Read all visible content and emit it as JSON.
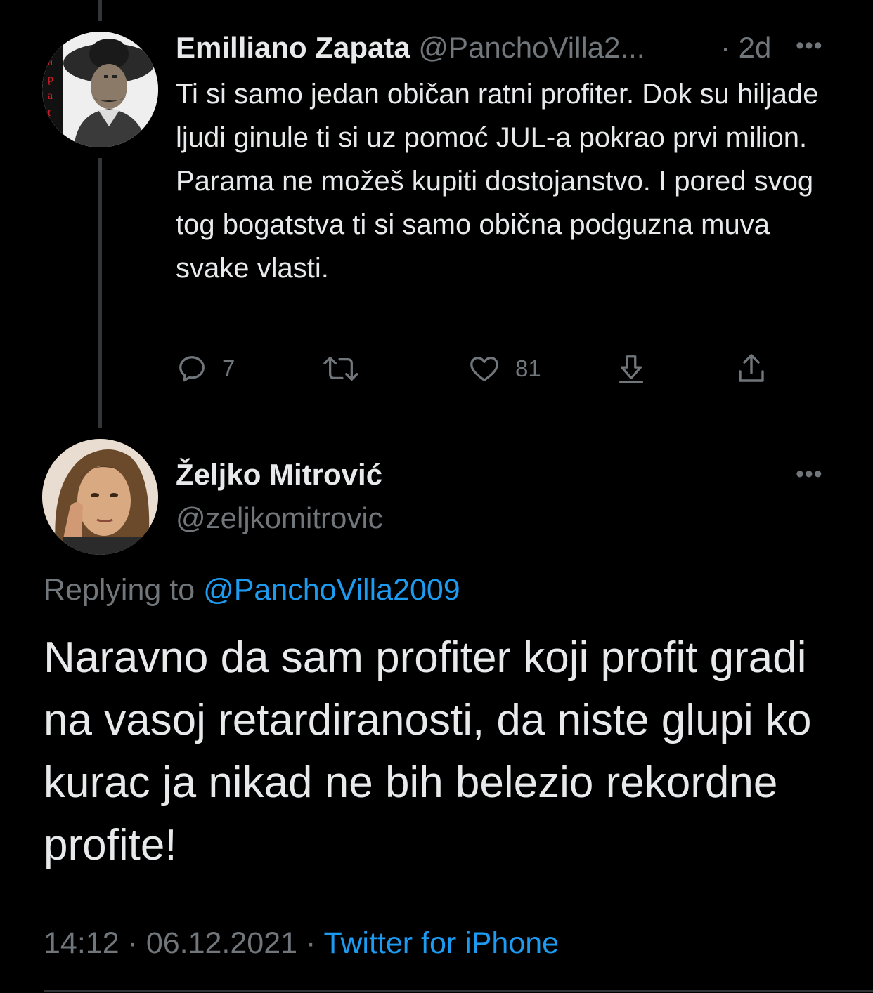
{
  "colors": {
    "background": "#000000",
    "text_primary": "#e7e9ea",
    "text_secondary": "#71767b",
    "link": "#1d9bf0",
    "thread_line": "#333639"
  },
  "parent_tweet": {
    "author_name": "Emilliano Zapata",
    "author_handle": "@PanchoVilla2...",
    "separator": "·",
    "time": "2d",
    "more_icon": "more-horizontal-icon",
    "text": "Ti si samo jedan običan ratni profiter. Dok su hiljade ljudi ginule ti si uz pomoć JUL-a pokrao prvi milion. Parama ne možeš kupiti dostojanstvo. I pored svog tog bogatstva ti si samo obična podguzna muva svake vlasti.",
    "actions": {
      "reply_icon": "reply-icon",
      "reply_count": "7",
      "retweet_icon": "retweet-icon",
      "like_icon": "heart-icon",
      "like_count": "81",
      "download_icon": "download-icon",
      "share_icon": "share-icon"
    }
  },
  "main_tweet": {
    "author_name": "Željko Mitrović",
    "author_handle": "@zeljkomitrovic",
    "more_icon": "more-horizontal-icon",
    "replying_prefix": "Replying to ",
    "replying_to": "@PanchoVilla2009",
    "text": "Naravno da sam profiter koji profit gradi na vasoj retardiranosti, da niste glupi ko kurac ja nikad ne bih belezio rekordne profite!",
    "time": "14:12",
    "separator": " · ",
    "date": "06.12.2021",
    "source": "Twitter for iPhone"
  }
}
